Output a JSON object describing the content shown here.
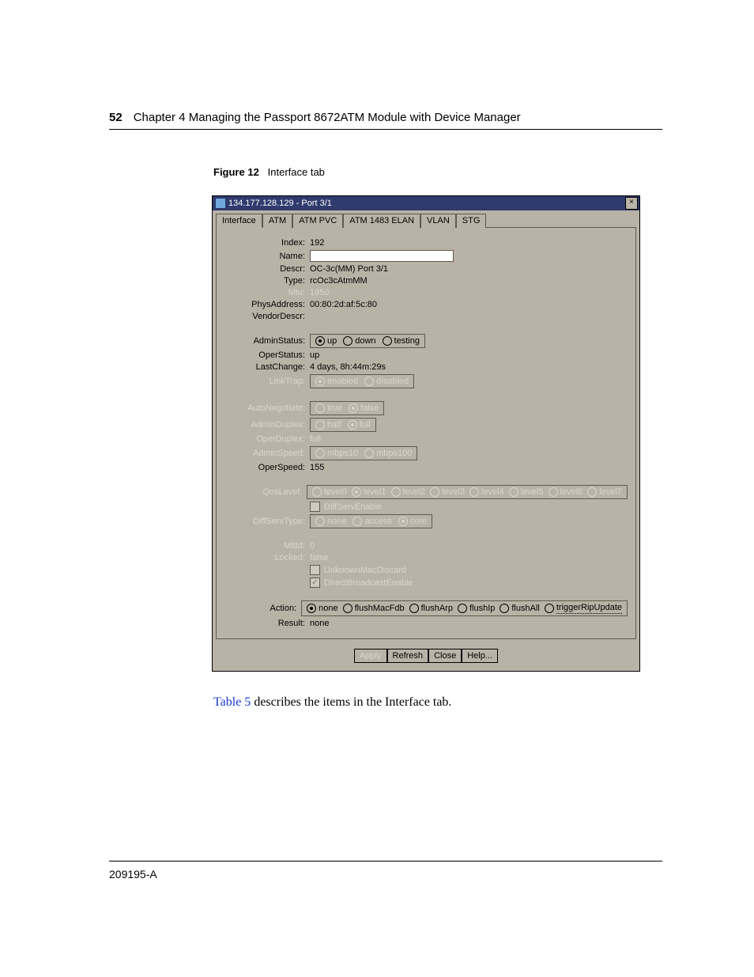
{
  "header": {
    "page_number": "52",
    "chapter": "Chapter 4  Managing the Passport 8672ATM Module with Device Manager"
  },
  "figure": {
    "label": "Figure 12",
    "title": "Interface tab"
  },
  "dialog": {
    "title": "134.177.128.129 - Port 3/1",
    "close_glyph": "×",
    "tabs": [
      "Interface",
      "ATM",
      "ATM PVC",
      "ATM 1483 ELAN",
      "VLAN",
      "STG"
    ],
    "rows": {
      "index": {
        "label": "Index:",
        "value": "192"
      },
      "name": {
        "label": "Name:",
        "value": ""
      },
      "descr": {
        "label": "Descr:",
        "value": "OC-3c(MM) Port 3/1"
      },
      "type": {
        "label": "Type:",
        "value": "rcOc3cAtmMM"
      },
      "mtu": {
        "label": "Mtu:",
        "value": "1950"
      },
      "physaddr": {
        "label": "PhysAddress:",
        "value": "00:80:2d:af:5c:80"
      },
      "vendordescr": {
        "label": "VendorDescr:",
        "value": ""
      },
      "adminstatus": {
        "label": "AdminStatus:",
        "options": [
          "up",
          "down",
          "testing"
        ],
        "selected": "up"
      },
      "operstatus": {
        "label": "OperStatus:",
        "value": "up"
      },
      "lastchange": {
        "label": "LastChange:",
        "value": "4 days, 8h:44m:29s"
      },
      "linktrap": {
        "label": "LinkTrap:",
        "options": [
          "enabled",
          "disabled"
        ],
        "selected": "enabled"
      },
      "autonegotiate": {
        "label": "AutoNegotiate:",
        "options": [
          "true",
          "false"
        ],
        "selected": "false"
      },
      "adminduplex": {
        "label": "AdminDuplex:",
        "options": [
          "half",
          "full"
        ],
        "selected": "full"
      },
      "operduplex": {
        "label": "OperDuplex:",
        "value": "full"
      },
      "adminspeed": {
        "label": "AdminSpeed:",
        "options": [
          "mbps10",
          "mbps100"
        ],
        "selected": ""
      },
      "operspeed": {
        "label": "OperSpeed:",
        "value": "155"
      },
      "qoslevel": {
        "label": "QosLevel:",
        "options": [
          "level0",
          "level1",
          "level2",
          "level3",
          "level4",
          "level5",
          "level6",
          "level7"
        ],
        "selected": "level1"
      },
      "diffservenable": {
        "label": "DiffServEnable",
        "checked": false
      },
      "diffservtype": {
        "label": "DiffServType:",
        "options": [
          "none",
          "access",
          "core"
        ],
        "selected": "core"
      },
      "mltid": {
        "label": "MltId:",
        "value": "0"
      },
      "locked": {
        "label": "Locked:",
        "value": "false"
      },
      "unknownmacdiscard": {
        "label": "UnknownMacDiscard",
        "checked": false
      },
      "directbroadcastenable": {
        "label": "DirectBroadcastEnable",
        "checked": true
      },
      "action": {
        "label": "Action:",
        "options": [
          "none",
          "flushMacFdb",
          "flushArp",
          "flushIp",
          "flushAll",
          "triggerRipUpdate"
        ],
        "selected": "none"
      },
      "result": {
        "label": "Result:",
        "value": "none"
      }
    },
    "buttons": {
      "apply": "Apply",
      "refresh": "Refresh",
      "close": "Close",
      "help": "Help..."
    }
  },
  "body_text": {
    "link": "Table 5",
    "rest": " describes the items in the Interface tab."
  },
  "footer": {
    "doc_id": "209195-A"
  }
}
